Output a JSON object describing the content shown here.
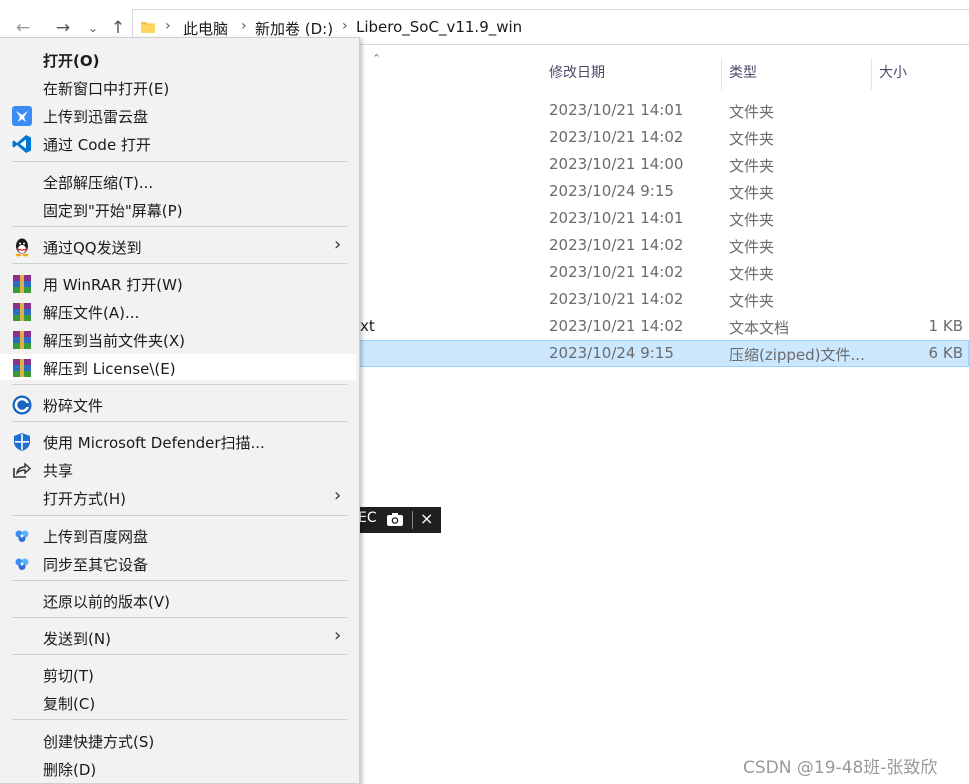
{
  "breadcrumb": [
    "此电脑",
    "新加卷 (D:)",
    "Libero_SoC_v11.9_win"
  ],
  "columns": {
    "date": "修改日期",
    "type": "类型",
    "size": "大小"
  },
  "files": [
    {
      "name": "",
      "date": "2023/10/21 14:01",
      "type": "文件夹",
      "size": ""
    },
    {
      "name": "",
      "date": "2023/10/21 14:02",
      "type": "文件夹",
      "size": ""
    },
    {
      "name": "",
      "date": "2023/10/21 14:00",
      "type": "文件夹",
      "size": ""
    },
    {
      "name": "",
      "date": "2023/10/24 9:15",
      "type": "文件夹",
      "size": ""
    },
    {
      "name": "",
      "date": "2023/10/21 14:01",
      "type": "文件夹",
      "size": ""
    },
    {
      "name": "",
      "date": "2023/10/21 14:02",
      "type": "文件夹",
      "size": ""
    },
    {
      "name": "",
      "date": "2023/10/21 14:02",
      "type": "文件夹",
      "size": ""
    },
    {
      "name": "",
      "date": "2023/10/21 14:02",
      "type": "文件夹",
      "size": ""
    },
    {
      "name": "xt",
      "date": "2023/10/21 14:02",
      "type": "文本文档",
      "size": "1 KB"
    },
    {
      "name": "",
      "date": "2023/10/24 9:15",
      "type": "压缩(zipped)文件...",
      "size": "6 KB"
    }
  ],
  "mini_toolbar": {
    "text": "EC",
    "camera_icon": "camera-icon",
    "close": "×"
  },
  "menu": {
    "open": "打开(O)",
    "open_new_window": "在新窗口中打开(E)",
    "upload_xunlei": "上传到迅雷云盘",
    "open_with_code": "通过 Code 打开",
    "extract_all": "全部解压缩(T)...",
    "pin_start": "固定到\"开始\"屏幕(P)",
    "send_qq": "通过QQ发送到",
    "open_winrar": "用 WinRAR 打开(W)",
    "extract_files": "解压文件(A)...",
    "extract_here": "解压到当前文件夹(X)",
    "extract_to": "解压到 License\\(E)",
    "shred": "粉碎文件",
    "defender": "使用 Microsoft Defender扫描...",
    "share": "共享",
    "open_with": "打开方式(H)",
    "upload_baidu": "上传到百度网盘",
    "sync_devices": "同步至其它设备",
    "restore": "还原以前的版本(V)",
    "send_to": "发送到(N)",
    "cut": "剪切(T)",
    "copy": "复制(C)",
    "create_shortcut": "创建快捷方式(S)",
    "delete": "删除(D)"
  },
  "watermark": "CSDN @19-48班-张致欣",
  "colors": {
    "selection": "#cce8ff",
    "menu_bg": "#f2f2f2",
    "vscode_blue": "#0078d4"
  }
}
